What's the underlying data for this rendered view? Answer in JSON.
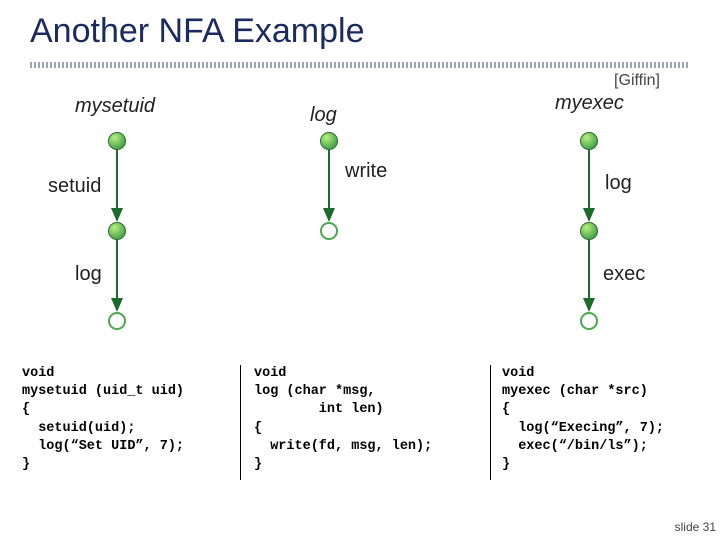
{
  "title": "Another NFA Example",
  "citation": "[Giffin]",
  "diagram": {
    "fn1_header": "mysetuid",
    "fn2_header": "log",
    "fn3_header": "myexec",
    "edge_setuid": "setuid",
    "edge_write": "write",
    "edge_log_left": "log",
    "edge_log_right": "log",
    "edge_exec": "exec"
  },
  "code": {
    "mysetuid": "void\nmysetuid (uid_t uid)\n{\n  setuid(uid);\n  log(“Set UID”, 7);\n}",
    "log": "void\nlog (char *msg,\n        int len)\n{\n  write(fd, msg, len);\n}",
    "myexec": "void\nmyexec (char *src)\n{\n  log(“Execing”, 7);\n  exec(“/bin/ls”);\n}"
  },
  "slide_number": "slide 31"
}
